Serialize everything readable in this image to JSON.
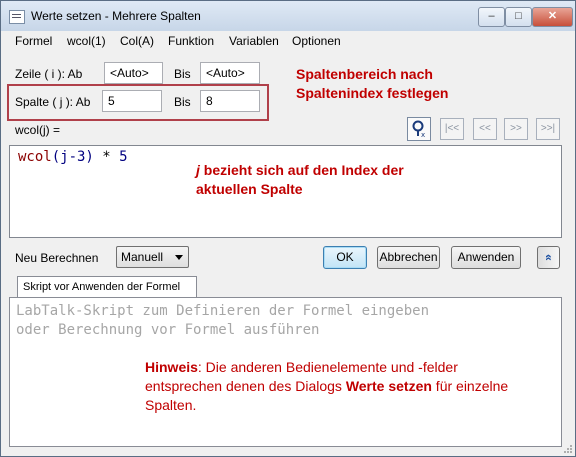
{
  "window": {
    "title": "Werte setzen - Mehrere Spalten",
    "minimize": "–",
    "maximize": "□",
    "close": "✕"
  },
  "menu": [
    "Formel",
    "wcol(1)",
    "Col(A)",
    "Funktion",
    "Variablen",
    "Optionen"
  ],
  "rows": {
    "label": "Zeile ( i ): Ab",
    "from": "<Auto>",
    "to_label": "Bis",
    "to": "<Auto>"
  },
  "cols": {
    "label": "Spalte ( j ): Ab",
    "from": "5",
    "to_label": "Bis",
    "to": "8"
  },
  "annotation_range": [
    "Spaltenbereich nach",
    "Spaltenindex festlegen"
  ],
  "formula_label": "wcol(j) =",
  "nav_buttons": [
    "|<<",
    "<<",
    ">>",
    ">>|"
  ],
  "formula": {
    "fn": "wcol",
    "arg": "(j-3)",
    "op": " * ",
    "num": "5"
  },
  "annotation_index": {
    "j": "j",
    "line1_rest": " bezieht sich auf den Index der",
    "line2": "aktuellen Spalte"
  },
  "recalc": {
    "label": "Neu Berechnen",
    "value": "Manuell"
  },
  "buttons": {
    "ok": "OK",
    "cancel": "Abbrechen",
    "apply": "Anwenden",
    "expand": "«"
  },
  "tab": "Skript vor Anwenden der Formel",
  "script_placeholder": "LabTalk-Skript zum Definieren der Formel eingeben\noder Berechnung vor Formel ausführen",
  "hint": {
    "bold": "Hinweis",
    "part1": ": Die anderen Bedienelemente und -felder entsprechen denen des Dialogs ",
    "bold2": "Werte setzen",
    "part2": " für einzelne Spalten."
  },
  "colors": {
    "annotation": "#c00000",
    "highlight_box": "#b0404a"
  }
}
